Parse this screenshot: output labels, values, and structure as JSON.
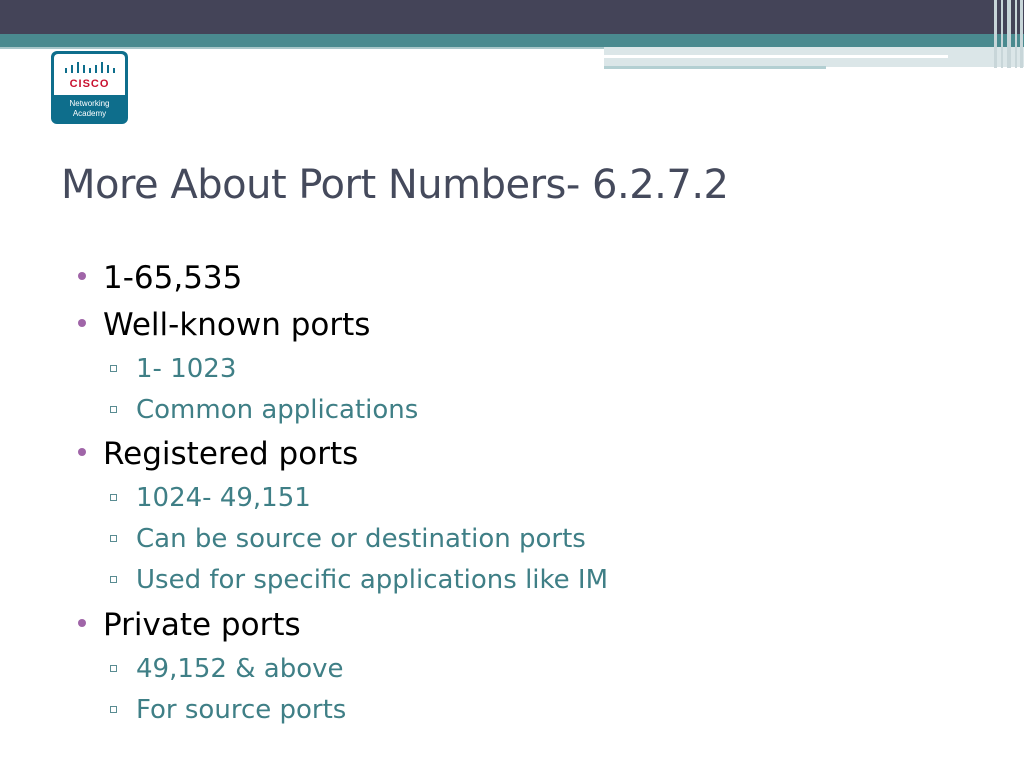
{
  "logo": {
    "brand": "CISCO",
    "line1": "Networking",
    "line2": "Academy"
  },
  "title": "More About Port Numbers- 6.2.7.2",
  "bullets": [
    {
      "text": "1-65,535",
      "subs": []
    },
    {
      "text": "Well-known ports",
      "subs": [
        "1- 1023",
        "Common applications"
      ]
    },
    {
      "text": "Registered ports",
      "subs": [
        "1024- 49,151",
        "Can be source or destination ports",
        "Used for specific applications like IM"
      ]
    },
    {
      "text": "Private ports",
      "subs": [
        "49,152 & above",
        "For source ports"
      ]
    }
  ],
  "colors": {
    "header_dark": "#444458",
    "header_teal": "#4a8a8f",
    "title": "#454a5c",
    "bullet_mark": "#a065a8",
    "sub_text": "#3f7f86"
  }
}
